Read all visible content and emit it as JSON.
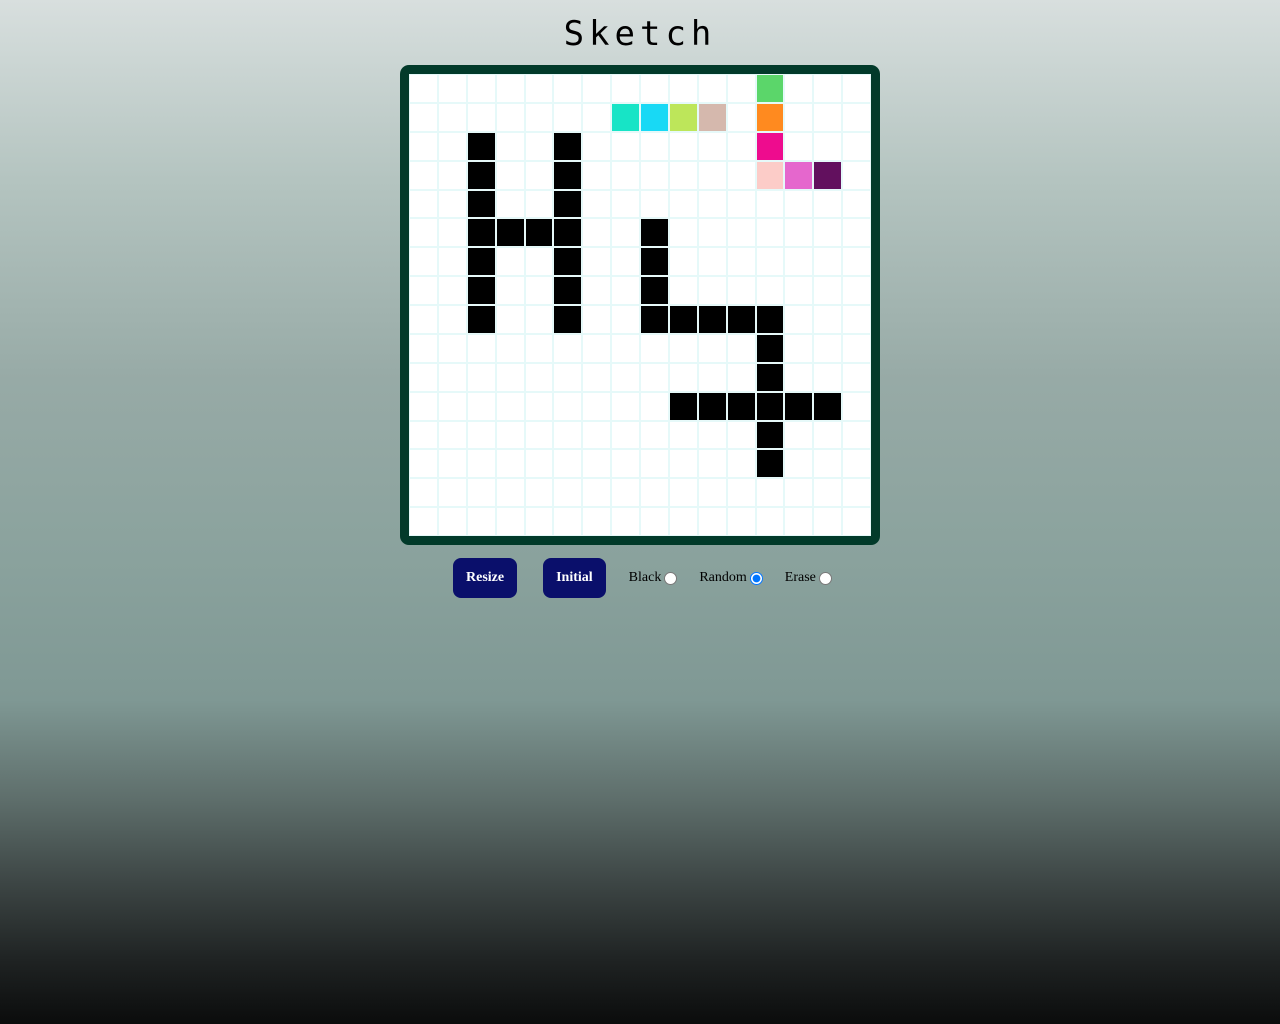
{
  "app": {
    "title": "Sketch"
  },
  "grid": {
    "size": 16,
    "default_color": "#ffffff",
    "painted": [
      {
        "row": 0,
        "col": 12,
        "color": "#5bd66a"
      },
      {
        "row": 1,
        "col": 7,
        "color": "#17e4c6"
      },
      {
        "row": 1,
        "col": 8,
        "color": "#18d9f5"
      },
      {
        "row": 1,
        "col": 9,
        "color": "#bde65a"
      },
      {
        "row": 1,
        "col": 10,
        "color": "#d5b8ad"
      },
      {
        "row": 1,
        "col": 12,
        "color": "#ff8a1f"
      },
      {
        "row": 2,
        "col": 2,
        "color": "#000000"
      },
      {
        "row": 2,
        "col": 5,
        "color": "#000000"
      },
      {
        "row": 2,
        "col": 12,
        "color": "#ee0c8e"
      },
      {
        "row": 3,
        "col": 2,
        "color": "#000000"
      },
      {
        "row": 3,
        "col": 5,
        "color": "#000000"
      },
      {
        "row": 3,
        "col": 12,
        "color": "#fcccc8"
      },
      {
        "row": 3,
        "col": 13,
        "color": "#e567cd"
      },
      {
        "row": 3,
        "col": 14,
        "color": "#62105e"
      },
      {
        "row": 4,
        "col": 2,
        "color": "#000000"
      },
      {
        "row": 4,
        "col": 5,
        "color": "#000000"
      },
      {
        "row": 5,
        "col": 2,
        "color": "#000000"
      },
      {
        "row": 5,
        "col": 3,
        "color": "#000000"
      },
      {
        "row": 5,
        "col": 4,
        "color": "#000000"
      },
      {
        "row": 5,
        "col": 5,
        "color": "#000000"
      },
      {
        "row": 5,
        "col": 8,
        "color": "#000000"
      },
      {
        "row": 6,
        "col": 2,
        "color": "#000000"
      },
      {
        "row": 6,
        "col": 5,
        "color": "#000000"
      },
      {
        "row": 6,
        "col": 8,
        "color": "#000000"
      },
      {
        "row": 7,
        "col": 2,
        "color": "#000000"
      },
      {
        "row": 7,
        "col": 5,
        "color": "#000000"
      },
      {
        "row": 7,
        "col": 8,
        "color": "#000000"
      },
      {
        "row": 8,
        "col": 2,
        "color": "#000000"
      },
      {
        "row": 8,
        "col": 5,
        "color": "#000000"
      },
      {
        "row": 8,
        "col": 8,
        "color": "#000000"
      },
      {
        "row": 8,
        "col": 9,
        "color": "#000000"
      },
      {
        "row": 8,
        "col": 10,
        "color": "#000000"
      },
      {
        "row": 8,
        "col": 11,
        "color": "#000000"
      },
      {
        "row": 8,
        "col": 12,
        "color": "#000000"
      },
      {
        "row": 9,
        "col": 12,
        "color": "#000000"
      },
      {
        "row": 10,
        "col": 12,
        "color": "#000000"
      },
      {
        "row": 11,
        "col": 9,
        "color": "#000000"
      },
      {
        "row": 11,
        "col": 10,
        "color": "#000000"
      },
      {
        "row": 11,
        "col": 11,
        "color": "#000000"
      },
      {
        "row": 11,
        "col": 12,
        "color": "#000000"
      },
      {
        "row": 11,
        "col": 13,
        "color": "#000000"
      },
      {
        "row": 11,
        "col": 14,
        "color": "#000000"
      },
      {
        "row": 12,
        "col": 12,
        "color": "#000000"
      },
      {
        "row": 13,
        "col": 12,
        "color": "#000000"
      }
    ]
  },
  "controls": {
    "resize_label": "Resize",
    "initial_label": "Initial",
    "modes": [
      {
        "label": "Black",
        "checked": false
      },
      {
        "label": "Random",
        "checked": true
      },
      {
        "label": "Erase",
        "checked": false
      }
    ]
  },
  "colors": {
    "frame": "#023a2a",
    "button_bg": "#0a0f6b",
    "cell_border": "#e6f9f9"
  }
}
